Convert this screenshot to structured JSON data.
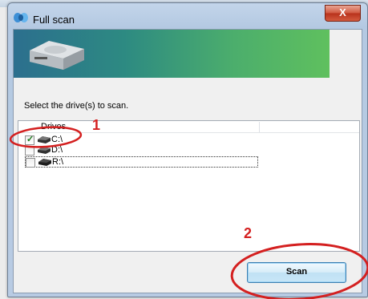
{
  "window": {
    "title": "Full scan",
    "close_label": "X"
  },
  "content": {
    "instruction": "Select the drive(s) to scan."
  },
  "drives_list": {
    "header": "Drives",
    "rows": [
      {
        "label": "C:\\",
        "checked": true
      },
      {
        "label": "D:\\",
        "checked": false
      },
      {
        "label": "R:\\",
        "checked": false
      }
    ]
  },
  "buttons": {
    "scan": "Scan"
  },
  "annotations": {
    "step1": "1",
    "step2": "2",
    "color": "#d42020"
  },
  "colors": {
    "banner_left": "#2c6f8e",
    "banner_right": "#5fc05e",
    "close_button": "#c8452c",
    "scan_border": "#3c7fb1"
  }
}
